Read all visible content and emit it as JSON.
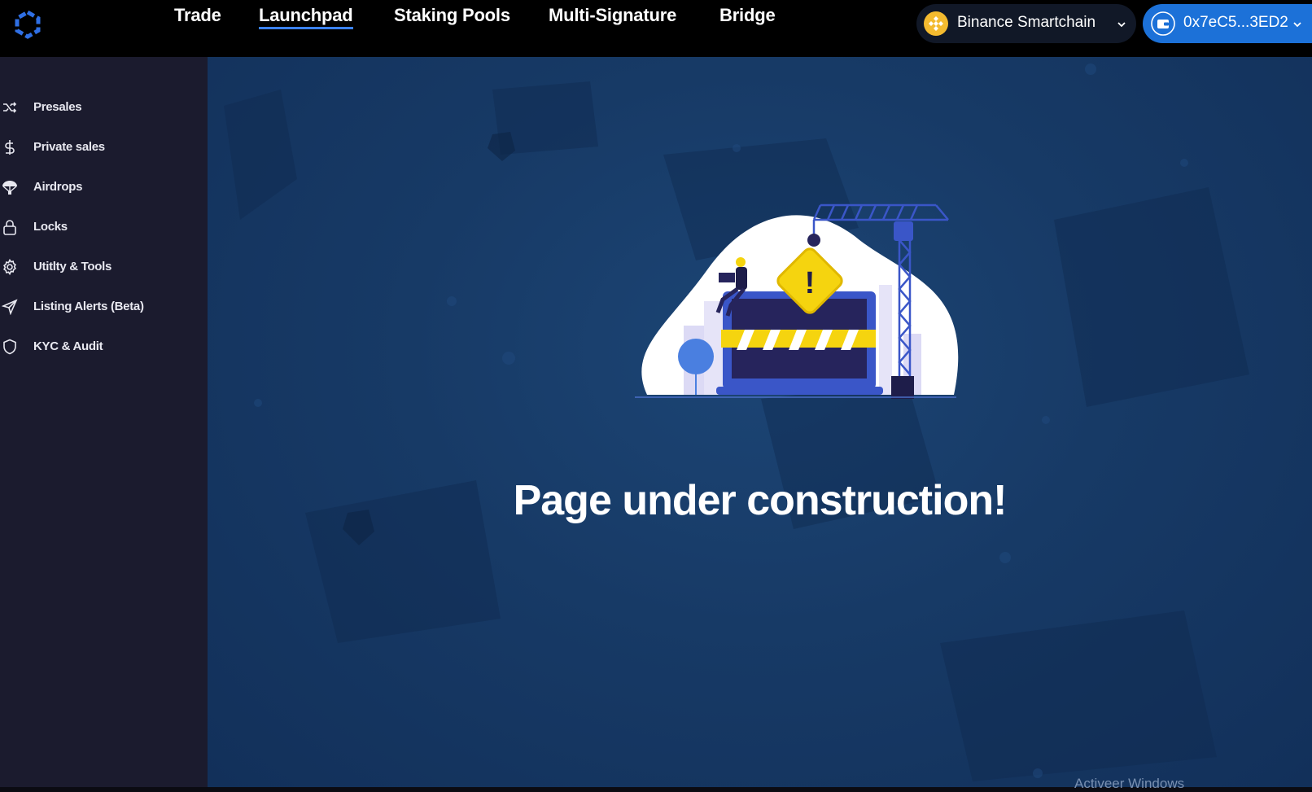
{
  "nav": {
    "links": [
      {
        "label": "Trade",
        "active": false
      },
      {
        "label": "Launchpad",
        "active": true
      },
      {
        "label": "Staking Pools",
        "active": false
      },
      {
        "label": "Multi-Signature",
        "active": false
      },
      {
        "label": "Bridge",
        "active": false
      }
    ],
    "accent_color": "#3b82f6"
  },
  "chain_selector": {
    "label": "Binance Smartchain",
    "icon": "bnb-coin-icon",
    "color": "#f3ba2f"
  },
  "wallet": {
    "label": "0x7eC5...3ED2",
    "icon": "wallet-icon",
    "color": "#1c71d8"
  },
  "sidebar": {
    "items": [
      {
        "label": "Presales",
        "icon": "shuffle-icon"
      },
      {
        "label": "Private sales",
        "icon": "dollar-icon"
      },
      {
        "label": "Airdrops",
        "icon": "parachute-icon"
      },
      {
        "label": "Locks",
        "icon": "lock-icon"
      },
      {
        "label": "Utitlty & Tools",
        "icon": "gear-icon"
      },
      {
        "label": "Listing Alerts (Beta)",
        "icon": "send-icon"
      },
      {
        "label": "KYC & Audit",
        "icon": "shield-icon"
      }
    ]
  },
  "main": {
    "headline": "Page under construction!",
    "illustration": "construction-illustration"
  },
  "os_watermark": "Activeer Windows"
}
